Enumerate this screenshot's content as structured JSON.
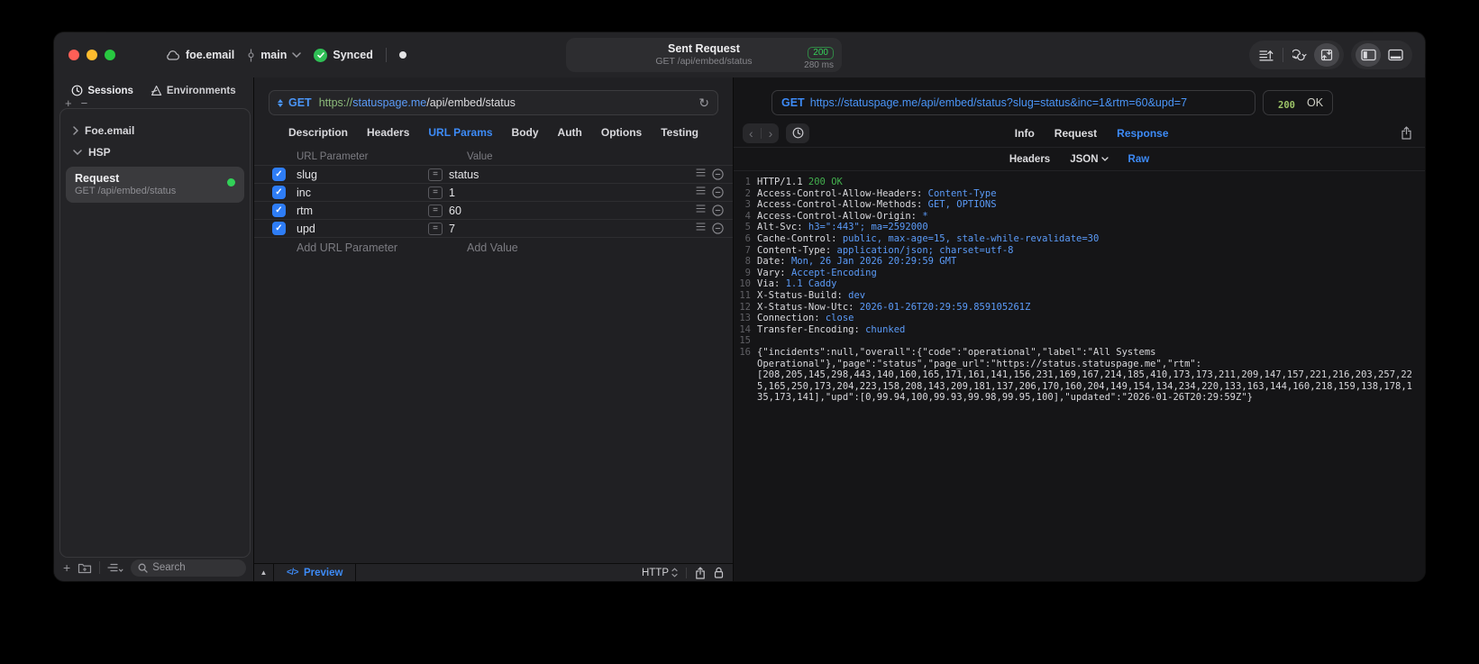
{
  "titlebar": {
    "project": "foe.email",
    "branch": "main",
    "sync_status": "Synced",
    "center": {
      "title": "Sent Request",
      "subtitle": "GET /api/embed/status",
      "status_code": "200",
      "duration": "280 ms"
    }
  },
  "sidebar": {
    "tabs": {
      "sessions": "Sessions",
      "environments": "Environments"
    },
    "tree": {
      "group1": "Foe.email",
      "group2": "HSP"
    },
    "request": {
      "title": "Request",
      "subtitle": "GET /api/embed/status"
    },
    "search_placeholder": "Search"
  },
  "request_panel": {
    "method": "GET",
    "url": {
      "scheme": "https://",
      "host": "statuspage.me",
      "path": "/api/embed/status"
    },
    "tabs": [
      "Description",
      "Headers",
      "URL Params",
      "Body",
      "Auth",
      "Options",
      "Testing"
    ],
    "active_tab": "URL Params",
    "table": {
      "col_param": "URL Parameter",
      "col_value": "Value",
      "rows": [
        {
          "name": "slug",
          "value": "status",
          "enabled": true
        },
        {
          "name": "inc",
          "value": "1",
          "enabled": true
        },
        {
          "name": "rtm",
          "value": "60",
          "enabled": true
        },
        {
          "name": "upd",
          "value": "7",
          "enabled": true
        }
      ],
      "add_param": "Add URL Parameter",
      "add_value": "Add Value"
    },
    "footer": {
      "preview": "Preview",
      "protocol": "HTTP"
    }
  },
  "response_panel": {
    "request_line": {
      "method": "GET",
      "url": "https://statuspage.me/api/embed/status?slug=status&inc=1&rtm=60&upd=7"
    },
    "status": {
      "code": "200",
      "text": "OK"
    },
    "tabs": [
      "Info",
      "Request",
      "Response"
    ],
    "active_tab": "Response",
    "subtabs": [
      "Headers",
      "JSON",
      "Raw"
    ],
    "active_subtab": "Raw",
    "response": {
      "status_line": {
        "protocol": "HTTP/1.1",
        "status": "200 OK"
      },
      "headers": [
        {
          "name": "Access-Control-Allow-Headers",
          "value": "Content-Type"
        },
        {
          "name": "Access-Control-Allow-Methods",
          "value": "GET, OPTIONS"
        },
        {
          "name": "Access-Control-Allow-Origin",
          "value": "*"
        },
        {
          "name": "Alt-Svc",
          "value": "h3=\":443\"; ma=2592000"
        },
        {
          "name": "Cache-Control",
          "value": "public, max-age=15, stale-while-revalidate=30"
        },
        {
          "name": "Content-Type",
          "value": "application/json; charset=utf-8"
        },
        {
          "name": "Date",
          "value": "Mon, 26 Jan 2026 20:29:59 GMT"
        },
        {
          "name": "Vary",
          "value": "Accept-Encoding"
        },
        {
          "name": "Via",
          "value": "1.1 Caddy"
        },
        {
          "name": "X-Status-Build",
          "value": "dev"
        },
        {
          "name": "X-Status-Now-Utc",
          "value": "2026-01-26T20:29:59.859105261Z"
        },
        {
          "name": "Connection",
          "value": "close"
        },
        {
          "name": "Transfer-Encoding",
          "value": "chunked"
        }
      ],
      "body": "{\"incidents\":null,\"overall\":{\"code\":\"operational\",\"label\":\"All Systems Operational\"},\"page\":\"status\",\"page_url\":\"https://status.statuspage.me\",\"rtm\":[208,205,145,298,443,140,160,165,171,161,141,156,231,169,167,214,185,410,173,173,211,209,147,157,221,216,203,257,225,165,250,173,204,223,158,208,143,209,181,137,206,170,160,204,149,154,134,234,220,133,163,144,160,218,159,138,178,135,173,141],\"upd\":[0,99.94,100,99.93,99.98,99.95,100],\"updated\":\"2026-01-26T20:29:59Z\"}"
    }
  },
  "icons": {
    "plus": "+",
    "minus": "−",
    "equals": "=",
    "check": "✓",
    "chevron-left": "‹",
    "chevron-right": "›",
    "refresh": "↻",
    "triangle-up": "▲",
    "code": "</>"
  },
  "colors": {
    "accent_blue": "#3d8bf7",
    "success_green": "#32d158",
    "status_code_green": "#9dc468",
    "traffic_red": "#ff5f57",
    "traffic_yellow": "#febc2e",
    "traffic_green": "#28c840"
  }
}
